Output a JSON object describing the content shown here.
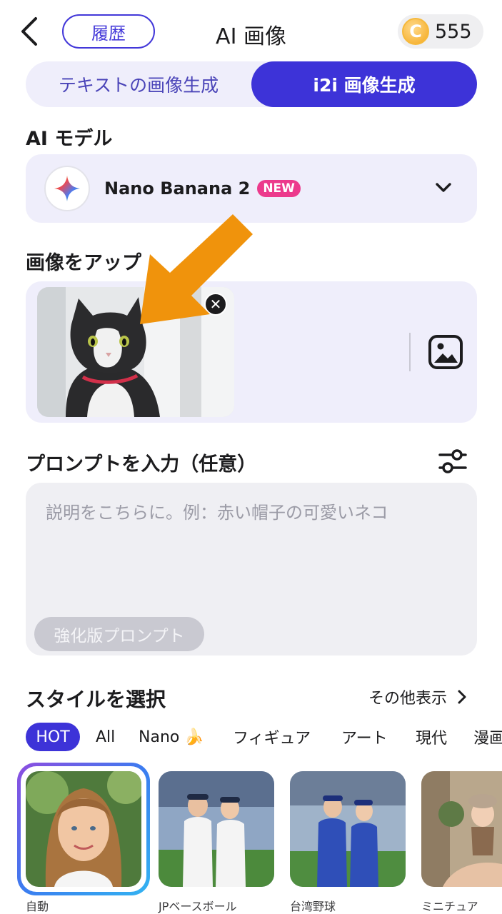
{
  "header": {
    "title": "AI 画像",
    "history_label": "履歴",
    "coin_count": "555",
    "coin_symbol": "C"
  },
  "tabs": [
    {
      "label": "テキストの画像生成",
      "active": false
    },
    {
      "label": "i2i 画像生成",
      "active": true
    }
  ],
  "model_section": {
    "label": "AI モデル",
    "model_name": "Nano Banana 2",
    "badge": "NEW"
  },
  "upload_section": {
    "label": "画像をアップ"
  },
  "prompt_section": {
    "label": "プロンプトを入力（任意）",
    "placeholder": "説明をこちらに。例：赤い帽子の可愛いネコ",
    "enhance_label": "強化版プロンプト"
  },
  "style_section": {
    "label": "スタイルを選択",
    "more_label": "その他表示",
    "chips": [
      "HOT",
      "All",
      "Nano 🍌",
      "フィギュア",
      "アート",
      "現代",
      "漫画"
    ],
    "active_chip": "HOT",
    "styles": [
      {
        "label": "自動",
        "selected": true
      },
      {
        "label": "JPベースボール",
        "selected": false
      },
      {
        "label": "台湾野球",
        "selected": false
      },
      {
        "label": "ミニチュア",
        "selected": false
      }
    ]
  },
  "colors": {
    "accent": "#3d33d8",
    "panel": "#efeefb",
    "annotation_arrow": "#f0930c",
    "new_badge": "#ec3a8c"
  }
}
